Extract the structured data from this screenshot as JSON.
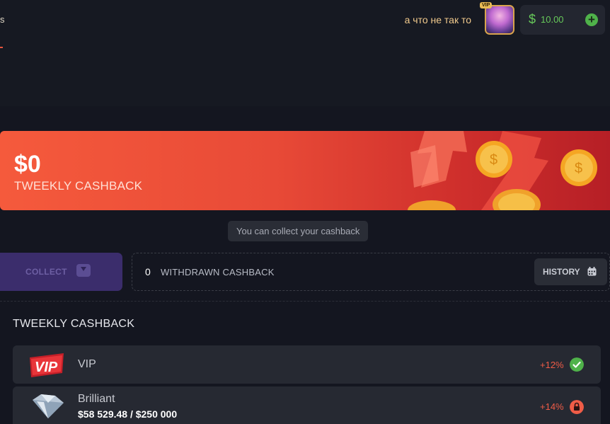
{
  "header": {
    "nav_fragment": "s",
    "username": "а что не так то",
    "vip_badge": "VIP",
    "balance": {
      "currency_symbol": "$",
      "amount": "10.00"
    },
    "accent_color": "#e5543d",
    "balance_color": "#67c95a"
  },
  "banner": {
    "amount": "$0",
    "label": "TWEEKLY CASHBACK"
  },
  "tooltip": {
    "text": "You can collect your cashback"
  },
  "actions": {
    "collect_label": "COLLECT",
    "withdrawn_value": "0",
    "withdrawn_label": "WITHDRAWN CASHBACK",
    "history_label": "HISTORY"
  },
  "levels_section": {
    "title": "TWEEKLY CASHBACK",
    "levels": [
      {
        "name": "VIP",
        "icon": "vip-badge-icon",
        "percent": "+12%",
        "status": "check-icon",
        "status_color": "#4fb24a"
      },
      {
        "name": "Brilliant",
        "icon": "diamond-icon",
        "progress": "$58 529.48 / $250 000",
        "percent": "+14%",
        "status": "lock-icon",
        "status_color": "#ef5c47"
      }
    ]
  }
}
